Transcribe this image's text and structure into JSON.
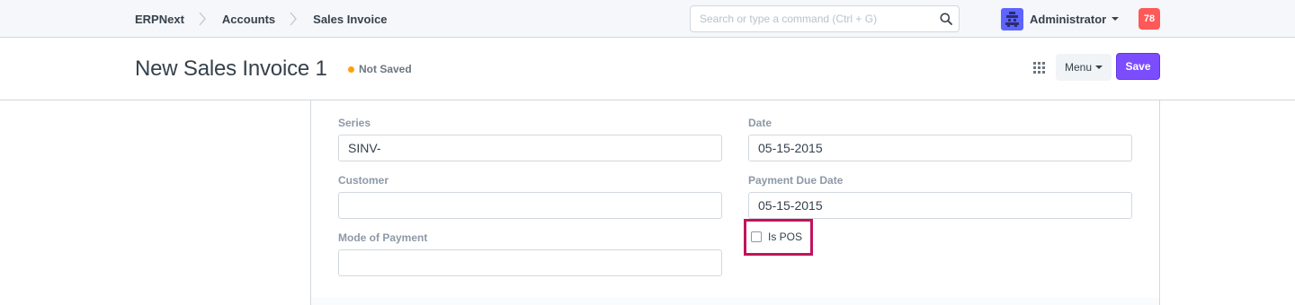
{
  "navbar": {
    "breadcrumbs": [
      "ERPNext",
      "Accounts",
      "Sales Invoice"
    ],
    "search_placeholder": "Search or type a command (Ctrl + G)",
    "user_name": "Administrator",
    "notification_count": "78"
  },
  "page_head": {
    "title": "New Sales Invoice 1",
    "status": "Not Saved",
    "status_color": "#ffa00a",
    "menu_label": "Menu",
    "save_label": "Save",
    "save_color": "#7c4dff"
  },
  "form": {
    "series": {
      "label": "Series",
      "value": "SINV-"
    },
    "date": {
      "label": "Date",
      "value": "05-15-2015"
    },
    "customer": {
      "label": "Customer",
      "value": ""
    },
    "payment_due_date": {
      "label": "Payment Due Date",
      "value": "05-15-2015"
    },
    "mode_of_payment": {
      "label": "Mode of Payment",
      "value": ""
    },
    "is_pos": {
      "label": "Is POS",
      "checked": false
    },
    "highlight_color": "#c1145c"
  }
}
